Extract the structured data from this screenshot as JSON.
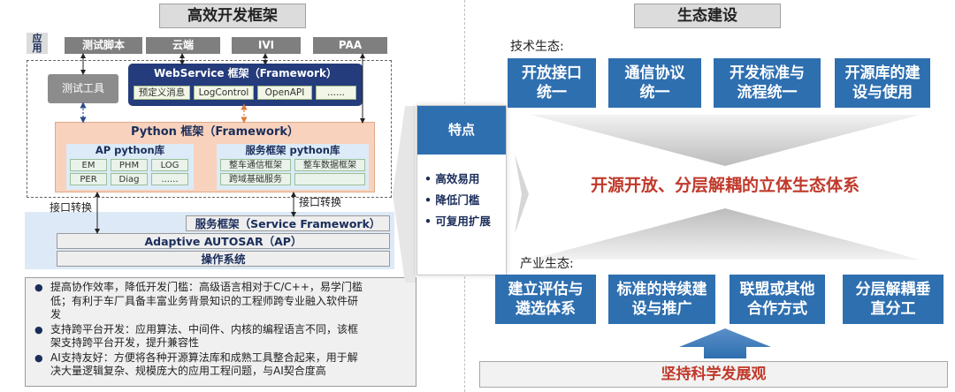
{
  "left": {
    "title": "高效开发框架",
    "app_label": "应用",
    "apps": [
      "测试脚本",
      "云端",
      "IVI",
      "PAA"
    ],
    "test_tool": "测试工具",
    "webservice": {
      "title": "WebService 框架（Framework）",
      "items": [
        "预定义消息",
        "LogControl",
        "OpenAPI",
        "......"
      ]
    },
    "python": {
      "title": "Python 框架（Framework）",
      "ap": {
        "title": "AP python库",
        "items": [
          "EM",
          "PHM",
          "LOG",
          "PER",
          "Diag",
          "......"
        ]
      },
      "svc": {
        "title": "服务框架 python库",
        "items": [
          "整车通信框架",
          "整车数据框架",
          "跨域基础服务",
          ""
        ]
      }
    },
    "iface_left": "接口转换",
    "iface_right": "接口转换",
    "service_framework": "服务框架（Service Framework）",
    "autosar": "Adaptive AUTOSAR（AP）",
    "os": "操作系统",
    "bullets": [
      [
        "提高协作效率，降低开发门槛：高级语言相对于C/C++，易学门槛",
        "低；有利于车厂具备丰富业务背景知识的工程师跨专业融入软件研",
        "发"
      ],
      [
        "支持跨平台开发：应用算法、中间件、内核的编程语言不同，该框",
        "架支持跨平台开发，提升兼容性"
      ],
      [
        "AI支持友好：方便将各种开源算法库和成熟工具整合起来，用于解",
        "决大量逻辑复杂、规模庞大的应用工程问题，与AI契合度高"
      ]
    ]
  },
  "middle": {
    "header": "特点",
    "items": [
      "高效易用",
      "降低门槛",
      "可复用扩展"
    ]
  },
  "right": {
    "title": "生态建设",
    "tech_label": "技术生态:",
    "tech_boxes": [
      [
        "开放接口",
        "统一"
      ],
      [
        "通信协议",
        "统一"
      ],
      [
        "开发标准与",
        "流程统一"
      ],
      [
        "开源库的建",
        "设与使用"
      ]
    ],
    "center_text": "开源开放、分层解耦的立体生态体系",
    "industry_label": "产业生态:",
    "industry_boxes": [
      [
        "建立评估与",
        "遴选体系"
      ],
      [
        "标准的持续建",
        "设与推广"
      ],
      [
        "联盟或其他",
        "合作方式"
      ],
      [
        "分层解耦垂",
        "直分工"
      ]
    ],
    "bottom": "坚持科学发展观"
  },
  "colors": {
    "blue_box": "#2e6fb0",
    "navy": "#203a78",
    "orange_fill": "#f8d2bd",
    "accent_orange": "#e07a3a",
    "red_text": "#c0392b"
  }
}
